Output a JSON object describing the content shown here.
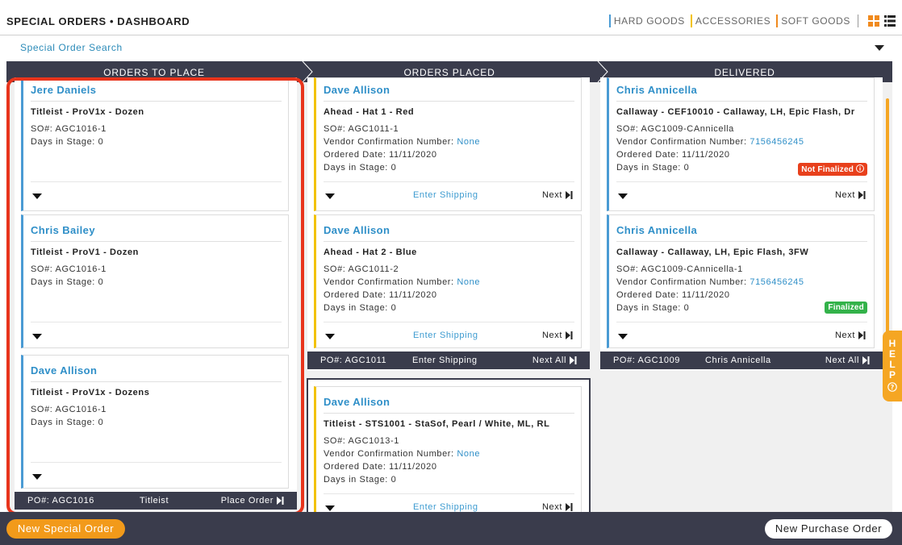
{
  "header": {
    "title": "SPECIAL ORDERS • DASHBOARD",
    "categories": [
      "HARD GOODS",
      "ACCESSORIES",
      "SOFT GOODS"
    ],
    "category_colors": [
      "#4a9bd4",
      "#f2c200",
      "#f08a1e"
    ],
    "view_icons": [
      "grid-view-icon",
      "list-view-icon"
    ]
  },
  "search": {
    "label": "Special Order Search"
  },
  "columns": [
    "ORDERS TO PLACE",
    "ORDERS PLACED",
    "DELIVERED"
  ],
  "to_place": {
    "cards": [
      {
        "name": "Jere Daniels",
        "product": "Titleist - ProV1x - Dozen",
        "so": "SO#: AGC1016-1",
        "days": "Days in Stage: 0"
      },
      {
        "name": "Chris Bailey",
        "product": "Titleist - ProV1 - Dozen",
        "so": "SO#: AGC1016-1",
        "days": "Days in Stage: 0"
      },
      {
        "name": "Dave Allison",
        "product": "Titleist - ProV1x - Dozens",
        "so": "SO#: AGC1016-1",
        "days": "Days in Stage: 0"
      }
    ],
    "po_bar": {
      "po": "PO#: AGC1016",
      "vendor": "Titleist",
      "action": "Place Order"
    }
  },
  "placed": {
    "cards": [
      {
        "name": "Dave Allison",
        "product": "Ahead - Hat 1 - Red",
        "so": "SO#: AGC1011-1",
        "vcn_label": "Vendor Confirmation Number:",
        "vcn_value": "None",
        "ordered": "Ordered Date: 11/11/2020",
        "days": "Days in Stage: 0",
        "ship": "Enter Shipping",
        "next": "Next"
      },
      {
        "name": "Dave Allison",
        "product": "Ahead - Hat 2 - Blue",
        "so": "SO#: AGC1011-2",
        "vcn_label": "Vendor Confirmation Number:",
        "vcn_value": "None",
        "ordered": "Ordered Date: 11/11/2020",
        "days": "Days in Stage: 0",
        "ship": "Enter Shipping",
        "next": "Next"
      }
    ],
    "po_bar": {
      "po": "PO#: AGC1011",
      "middle": "Enter Shipping",
      "action": "Next All"
    },
    "group2_cards": [
      {
        "name": "Dave Allison",
        "product": "Titleist - STS1001 - StaSof, Pearl / White, ML, RL",
        "so": "SO#: AGC1013-1",
        "vcn_label": "Vendor Confirmation Number:",
        "vcn_value": "None",
        "ordered": "Ordered Date: 11/11/2020",
        "days": "Days in Stage: 0",
        "ship": "Enter Shipping",
        "next": "Next"
      }
    ]
  },
  "delivered": {
    "cards": [
      {
        "name": "Chris Annicella",
        "product": "Callaway - CEF10010 - Callaway, LH, Epic Flash, Dr",
        "so": "SO#: AGC1009-CAnnicella",
        "vcn_label": "Vendor Confirmation Number:",
        "vcn_value": "7156456245",
        "ordered": "Ordered Date: 11/11/2020",
        "days": "Days in Stage: 0",
        "badge": "Not Finalized",
        "next": "Next"
      },
      {
        "name": "Chris Annicella",
        "product": "Callaway - Callaway, LH, Epic Flash, 3FW",
        "so": "SO#: AGC1009-CAnnicella-1",
        "vcn_label": "Vendor Confirmation Number:",
        "vcn_value": "7156456245",
        "ordered": "Ordered Date: 11/11/2020",
        "days": "Days in Stage: 0",
        "badge": "Finalized",
        "next": "Next"
      }
    ],
    "po_bar": {
      "po": "PO#: AGC1009",
      "middle": "Chris Annicella",
      "action": "Next All"
    }
  },
  "help": {
    "letters": [
      "H",
      "E",
      "L",
      "P"
    ]
  },
  "footer": {
    "new_special_order": "New Special Order",
    "new_purchase_order": "New Purchase Order"
  }
}
